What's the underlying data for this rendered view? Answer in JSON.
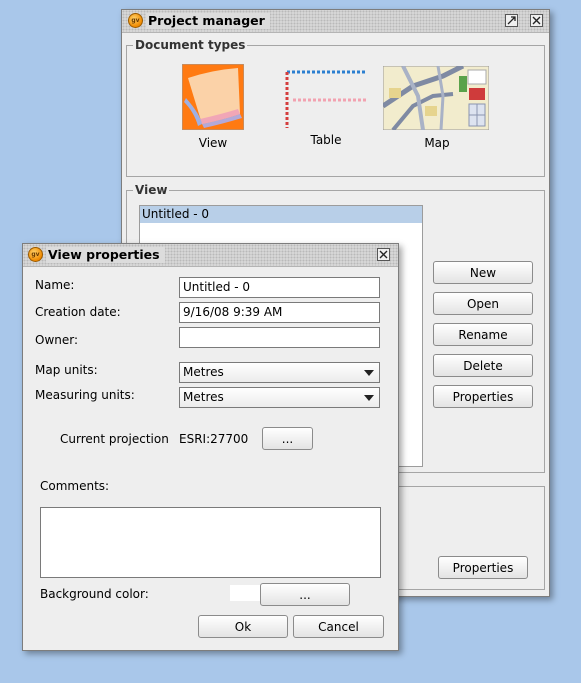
{
  "project_manager": {
    "title": "Project manager",
    "document_types": {
      "group_title": "Document types",
      "items": [
        "View",
        "Table",
        "Map"
      ]
    },
    "view_section": {
      "group_title": "View",
      "list_items": [
        "Untitled - 0"
      ],
      "buttons": {
        "new": "New",
        "open": "Open",
        "rename": "Rename",
        "delete": "Delete",
        "properties": "Properties"
      }
    },
    "bottom_properties_button": "Properties"
  },
  "view_properties": {
    "title": "View properties",
    "name_label": "Name:",
    "name_value": "Untitled - 0",
    "creation_date_label": "Creation date:",
    "creation_date_value": "9/16/08 9:39 AM",
    "owner_label": "Owner:",
    "owner_value": "",
    "map_units_label": "Map units:",
    "map_units_value": "Metres",
    "measuring_units_label": "Measuring units:",
    "measuring_units_value": "Metres",
    "projection_label": "Current projection",
    "projection_value": "ESRI:27700",
    "projection_button": "...",
    "comments_label": "Comments:",
    "comments_value": "",
    "background_color_label": "Background color:",
    "background_color_value": "#ffffff",
    "background_color_button": "...",
    "ok_button": "Ok",
    "cancel_button": "Cancel"
  },
  "icons": {
    "app": "gvsig-app-icon",
    "maximize": "maximize-icon",
    "close": "close-icon",
    "view_doc": "view-document-icon",
    "table_doc": "table-document-icon",
    "map_doc": "map-document-icon",
    "dropdown": "chevron-down-icon"
  }
}
